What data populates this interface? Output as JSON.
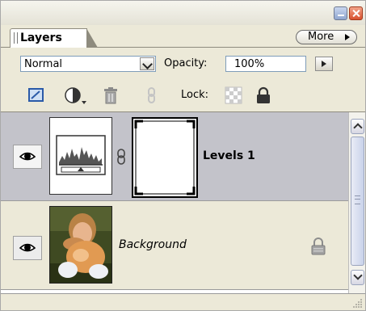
{
  "panel": {
    "tab_label": "Layers",
    "more_label": "More"
  },
  "controls": {
    "blend_mode": "Normal",
    "opacity_label": "Opacity:",
    "opacity_value": "100%"
  },
  "toolbar": {
    "icons": [
      "new-fill-layer-icon",
      "adjustment-layer-icon",
      "trash-icon",
      "link-icon"
    ],
    "lock_label": "Lock:"
  },
  "layers": [
    {
      "name": "Levels 1",
      "visible": true,
      "selected": true,
      "type": "adjustment"
    },
    {
      "name": "Background",
      "visible": true,
      "locked": true,
      "type": "image"
    }
  ],
  "colors": {
    "panel_bg": "#ece9d8",
    "selected_row": "#c3c3ca"
  }
}
